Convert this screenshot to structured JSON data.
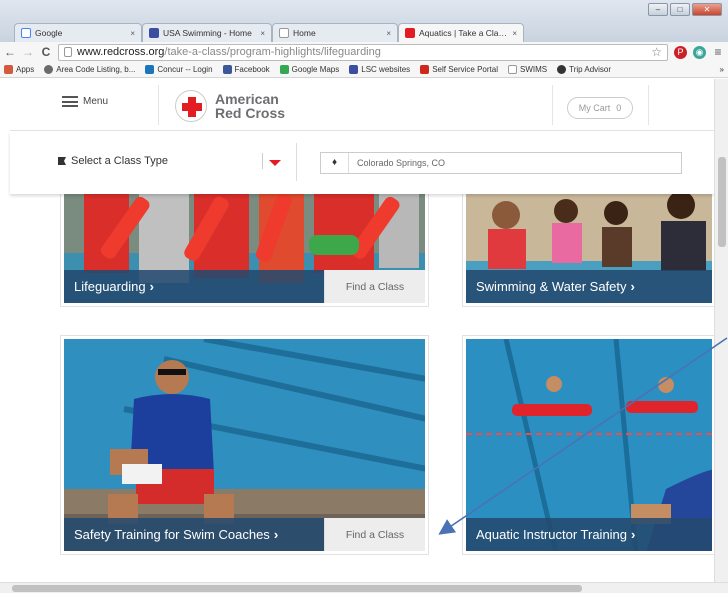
{
  "browser": {
    "tabs": [
      {
        "title": "Google",
        "favicon": "google-icon",
        "color": "#4285f4",
        "close": "×"
      },
      {
        "title": "USA Swimming - Home",
        "favicon": "usa-swimming-icon",
        "color": "#3b4ea0",
        "close": "×"
      },
      {
        "title": "Home",
        "favicon": "page-icon",
        "color": "#ffffff",
        "close": "×"
      },
      {
        "title": "Aquatics | Take a Class | A",
        "favicon": "red-cross-icon",
        "color": "#e31b23",
        "close": "×"
      }
    ],
    "window_buttons": [
      "–",
      "□",
      "✕"
    ],
    "nav": {
      "back": "←",
      "forward": "→",
      "reload": "C"
    },
    "url_domain": "www.redcross.org",
    "url_path": "/take-a-class/program-highlights/lifeguarding",
    "star": "☆",
    "menu": "≡",
    "bookmarks_overflow": "»",
    "bookmarks": [
      {
        "label": "Apps",
        "icon": "apps-icon",
        "color": "#d35b3d"
      },
      {
        "label": "Area Code Listing, b...",
        "icon": "pin-icon",
        "color": "#6a6a6a"
      },
      {
        "label": "Concur -- Login",
        "icon": "concur-icon",
        "color": "#1b75bb"
      },
      {
        "label": "Facebook",
        "icon": "facebook-icon",
        "color": "#3b5998"
      },
      {
        "label": "Google Maps",
        "icon": "maps-icon",
        "color": "#34a853"
      },
      {
        "label": "LSC websites",
        "icon": "usa-swimming-icon",
        "color": "#3b4ea0"
      },
      {
        "label": "Self Service Portal",
        "icon": "adp-icon",
        "color": "#d0271d"
      },
      {
        "label": "SWIMS",
        "icon": "page-icon",
        "color": "#ffffff"
      },
      {
        "label": "Trip Advisor",
        "icon": "tripadvisor-icon",
        "color": "#333333"
      }
    ]
  },
  "header": {
    "menu_label": "Menu",
    "logo_line1": "American",
    "logo_line2": "Red Cross",
    "cart_label": "My Cart",
    "cart_count": "0"
  },
  "filter": {
    "class_type": "Select a Class Type",
    "location": "Colorado Springs, CO"
  },
  "cards": [
    {
      "title": "Lifeguarding",
      "chev": "›",
      "find": "Find a Class"
    },
    {
      "title": "Swimming & Water Safety",
      "chev": "›",
      "find": ""
    },
    {
      "title": "Safety Training for Swim Coaches",
      "chev": "›",
      "find": "Find a Class"
    },
    {
      "title": "Aquatic Instructor Training",
      "chev": "›",
      "find": ""
    }
  ],
  "colors": {
    "brand_red": "#e31b23",
    "card_bar": "#244a6e"
  }
}
